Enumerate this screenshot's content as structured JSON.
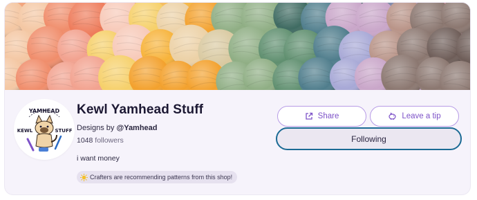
{
  "shop": {
    "name": "Kewl Yamhead Stuff",
    "designs_prefix": "Designs by",
    "designer_handle": "@Yamhead",
    "followers_count": "1048",
    "followers_label": "followers",
    "bio": "i want money",
    "badge_text": "Crafters are recommending patterns from this shop!"
  },
  "avatar": {
    "text_top": "YAMHEAD",
    "text_left": "KEWL",
    "text_right": "STUFF"
  },
  "actions": {
    "share_label": "Share",
    "tip_label": "Leave a tip",
    "follow_label": "Following"
  },
  "icons": {
    "share": "share-external-icon",
    "tip": "piggy-bank-icon",
    "badge": "sun-icon"
  },
  "colors": {
    "accent": "#7d52c8",
    "accent_border": "#b79be6",
    "follow_border": "#1a6a94",
    "card_bg": "#f6f3fb"
  }
}
